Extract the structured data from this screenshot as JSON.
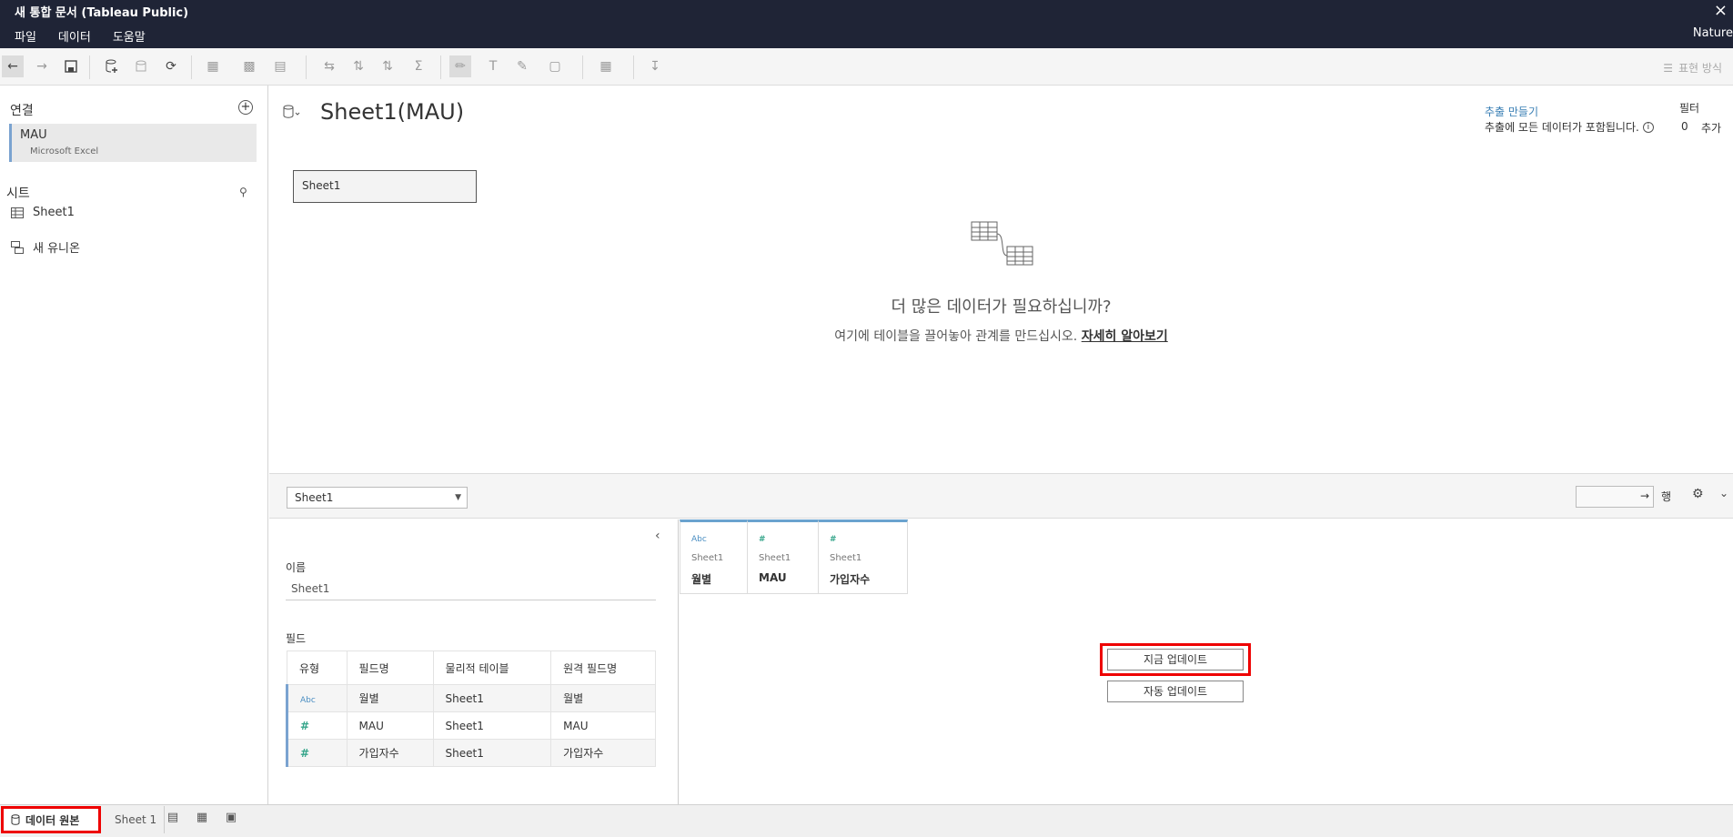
{
  "window": {
    "title": "새 통합 문서 (Tableau Public)",
    "close_icon": "×"
  },
  "menu": {
    "items": [
      "파일",
      "데이터",
      "도움말"
    ],
    "right_label": "Nature"
  },
  "toolbar": {
    "right_label": "표현 방식"
  },
  "left_pane": {
    "connections_title": "연결",
    "connection": {
      "name": "MAU",
      "type": "Microsoft Excel"
    },
    "sheets_title": "시트",
    "sheets": [
      "Sheet1"
    ],
    "new_union": "새 유니온"
  },
  "canvas": {
    "datasource_title": "Sheet1(MAU)",
    "extract_link": "추출 만들기",
    "extract_note": "추출에 모든 데이터가 포함됩니다.",
    "filters_label": "필터",
    "filters_count": "0",
    "filters_add": "추가",
    "table_box": "Sheet1",
    "more_data_title": "더 많은 데이터가 필요하십니까?",
    "more_data_desc": "여기에 테이블을 끌어놓아 관계를 만드십시오.",
    "more_data_link": "자세히 알아보기"
  },
  "grid_bar": {
    "selected_table": "Sheet1",
    "rows_label": "행"
  },
  "meta": {
    "name_label": "이름",
    "name_value": "Sheet1",
    "fields_label": "필드",
    "headers": [
      "유형",
      "필드명",
      "물리적 테이블",
      "원격 필드명"
    ],
    "rows": [
      {
        "type": "Abc",
        "field": "월별",
        "table": "Sheet1",
        "remote": "월별"
      },
      {
        "type": "#",
        "field": "MAU",
        "table": "Sheet1",
        "remote": "MAU"
      },
      {
        "type": "#",
        "field": "가입자수",
        "table": "Sheet1",
        "remote": "가입자수"
      }
    ]
  },
  "data_grid": {
    "columns": [
      {
        "type": "Abc",
        "source": "Sheet1",
        "name": "월별"
      },
      {
        "type": "#",
        "source": "Sheet1",
        "name": "MAU"
      },
      {
        "type": "#",
        "source": "Sheet1",
        "name": "가입자수"
      }
    ],
    "update_now": "지금 업데이트",
    "auto_update": "자동 업데이트"
  },
  "tabs": {
    "datasource": "데이터 원본",
    "sheet": "Sheet 1"
  },
  "colors": {
    "title_bar": "#1f2436",
    "accent_blue": "#4a8ec2",
    "highlight_red": "#e00000",
    "number_green": "#35a58a"
  }
}
